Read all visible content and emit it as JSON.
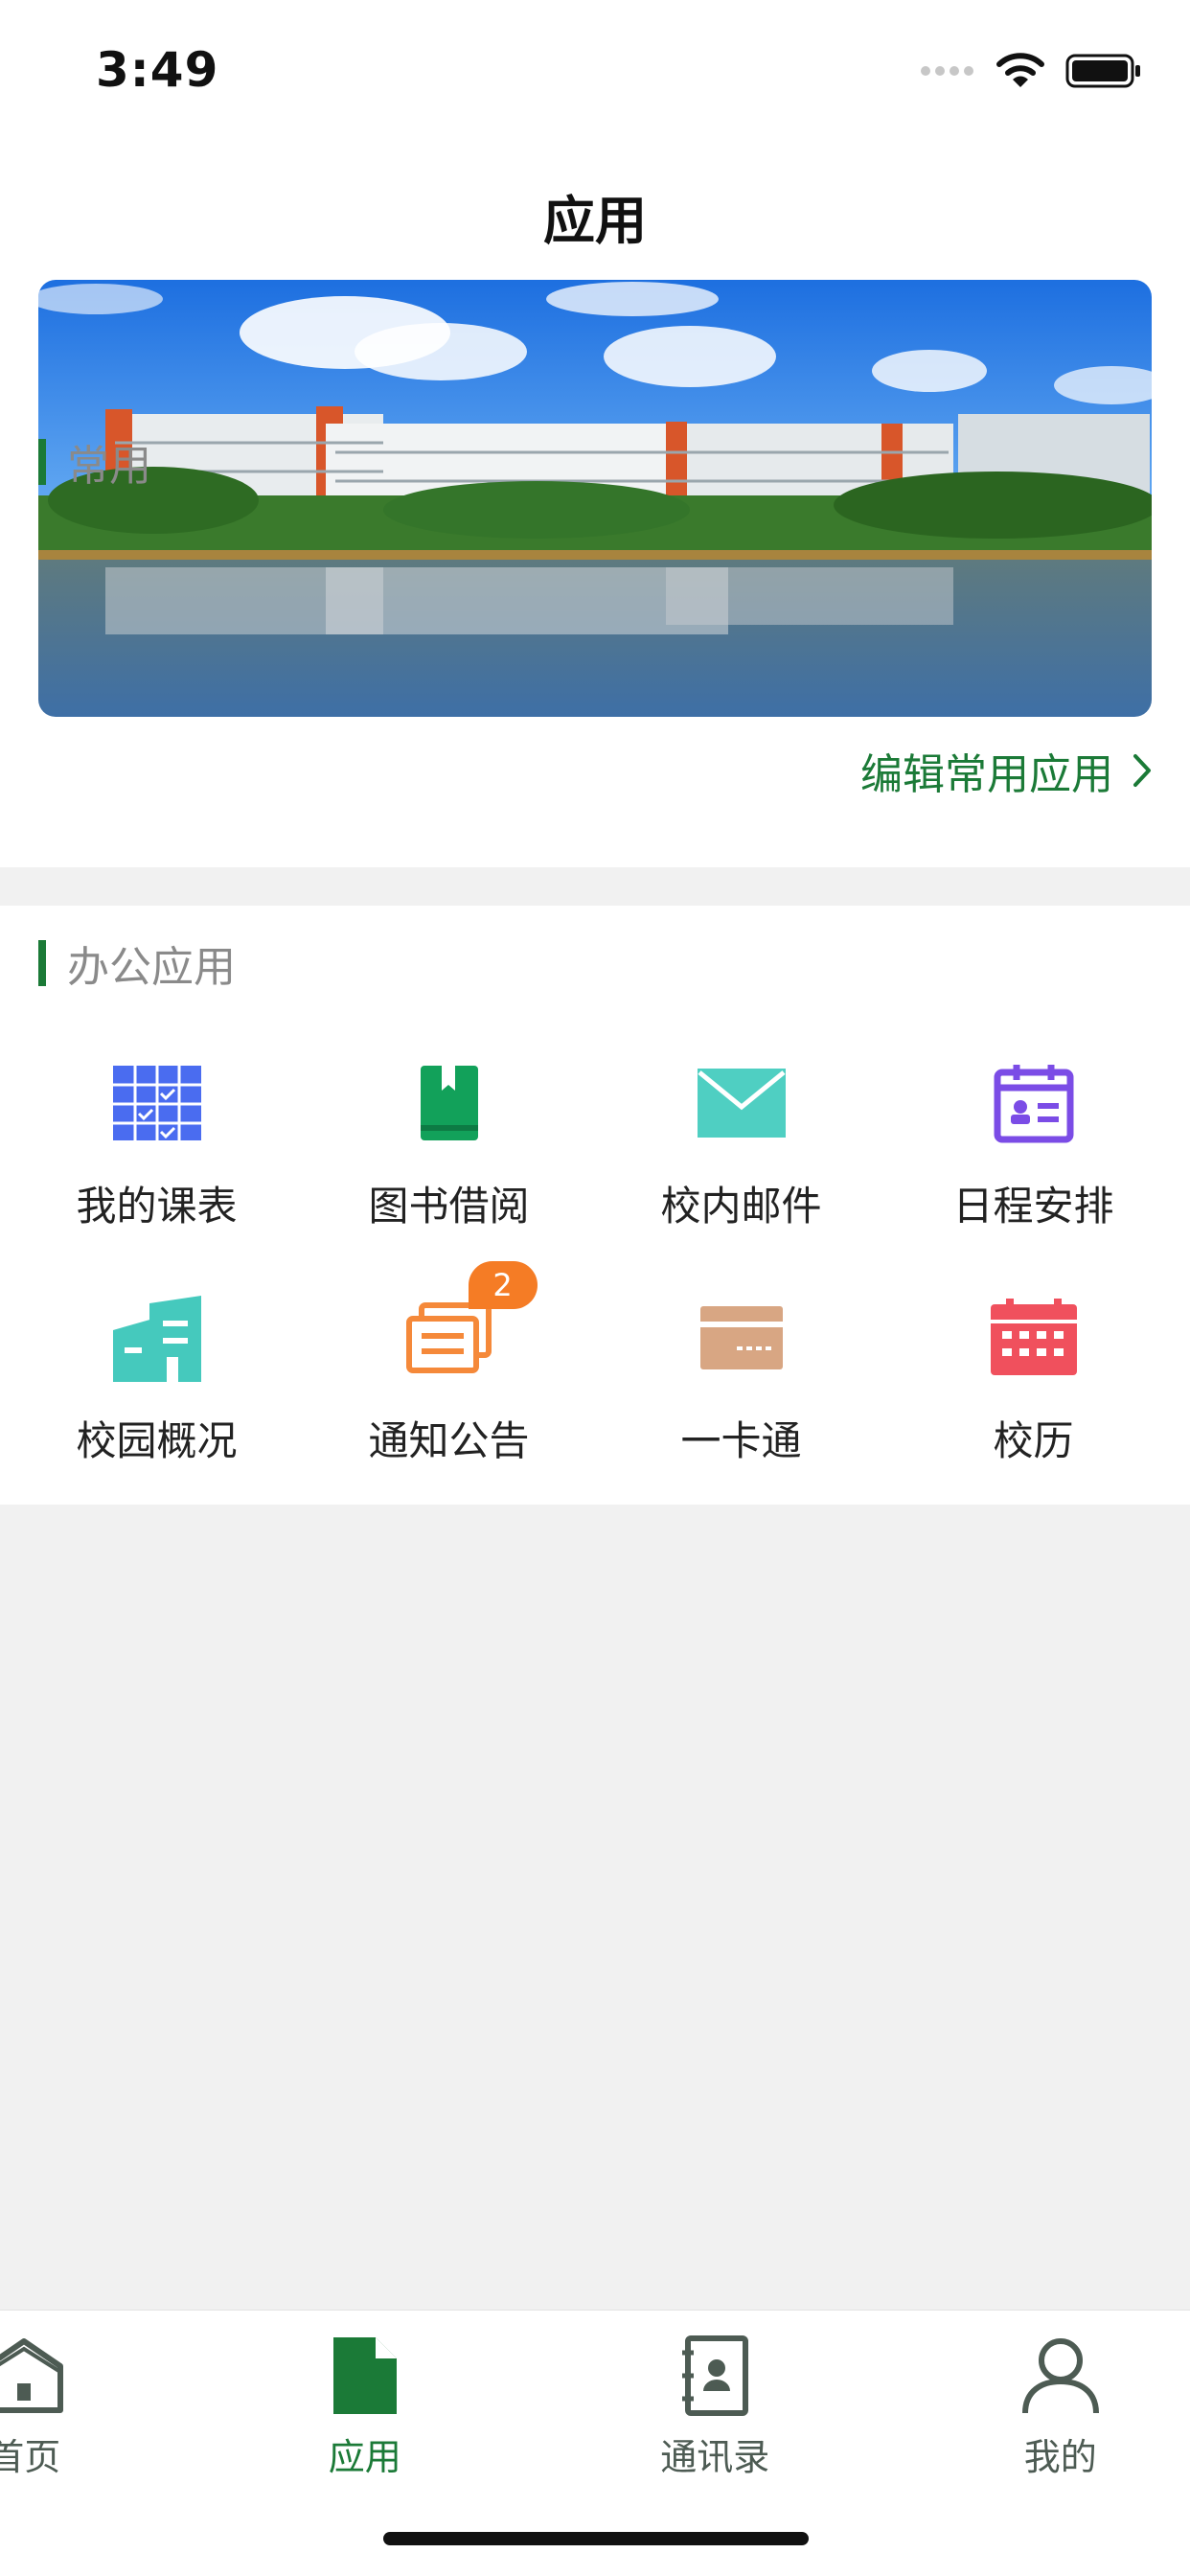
{
  "status_bar": {
    "time": "3:49"
  },
  "nav": {
    "title": "应用"
  },
  "common": {
    "label": "常用",
    "edit_label": "编辑常用应用"
  },
  "office": {
    "label": "办公应用",
    "apps": [
      {
        "label": "我的课表",
        "icon": "timetable-icon",
        "color": "#4a6cf0"
      },
      {
        "label": "图书借阅",
        "icon": "book-icon",
        "color": "#12a15a"
      },
      {
        "label": "校内邮件",
        "icon": "mail-icon",
        "color": "#4fcfc2"
      },
      {
        "label": "日程安排",
        "icon": "schedule-icon",
        "color": "#7b4ce6"
      },
      {
        "label": "校园概况",
        "icon": "campus-building-icon",
        "color": "#45c9bd"
      },
      {
        "label": "通知公告",
        "icon": "notice-icon",
        "color": "#f5893a",
        "badge": "2"
      },
      {
        "label": "一卡通",
        "icon": "card-icon",
        "color": "#d8a683"
      },
      {
        "label": "校历",
        "icon": "calendar-icon",
        "color": "#f0505d"
      }
    ]
  },
  "tabs": [
    {
      "label": "首页",
      "icon": "home-icon",
      "active": false
    },
    {
      "label": "应用",
      "icon": "app-document-icon",
      "active": true
    },
    {
      "label": "通讯录",
      "icon": "contacts-icon",
      "active": false
    },
    {
      "label": "我的",
      "icon": "profile-icon",
      "active": false
    }
  ],
  "colors": {
    "accent": "#1b7a37",
    "badge": "#f57c25",
    "background": "#f1f1f1"
  }
}
